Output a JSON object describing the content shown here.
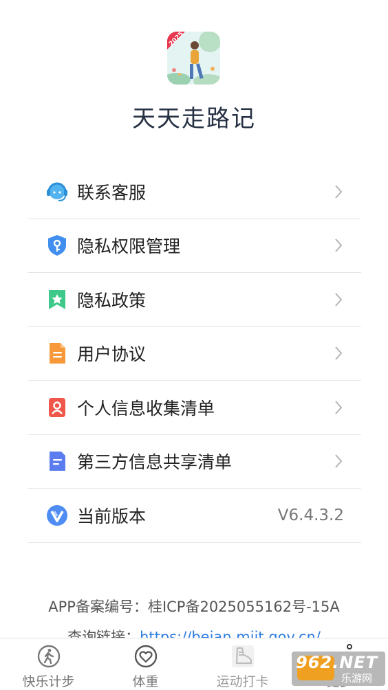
{
  "app": {
    "name": "天天走路记",
    "logo_badge": "2025"
  },
  "menu": {
    "items": [
      {
        "label": "联系客服",
        "icon": "customer-service-icon"
      },
      {
        "label": "隐私权限管理",
        "icon": "shield-key-icon"
      },
      {
        "label": "隐私政策",
        "icon": "bookmark-star-icon"
      },
      {
        "label": "用户协议",
        "icon": "document-icon"
      },
      {
        "label": "个人信息收集清单",
        "icon": "person-card-icon"
      },
      {
        "label": "第三方信息共享清单",
        "icon": "list-document-icon"
      },
      {
        "label": "当前版本",
        "icon": "version-v-icon",
        "value": "V6.4.3.2"
      }
    ]
  },
  "footer": {
    "icp": "APP备案编号：桂ICP备2025055162号-15A",
    "query_label": "查询链接：",
    "query_link": "https://beian.miit.gov.cn/"
  },
  "tabbar": {
    "tabs": [
      {
        "label": "快乐计步",
        "icon": "walking-icon"
      },
      {
        "label": "体重",
        "icon": "heart-icon"
      },
      {
        "label": "运动打卡",
        "icon": "sneaker-icon"
      },
      {
        "label": "更多",
        "icon": "more-icon"
      }
    ]
  },
  "watermark": {
    "main": "962.NET",
    "sub": "乐游网"
  },
  "colors": {
    "accent_link": "#2f7de1",
    "text_primary": "#222222",
    "divider": "#e6e6e6"
  }
}
